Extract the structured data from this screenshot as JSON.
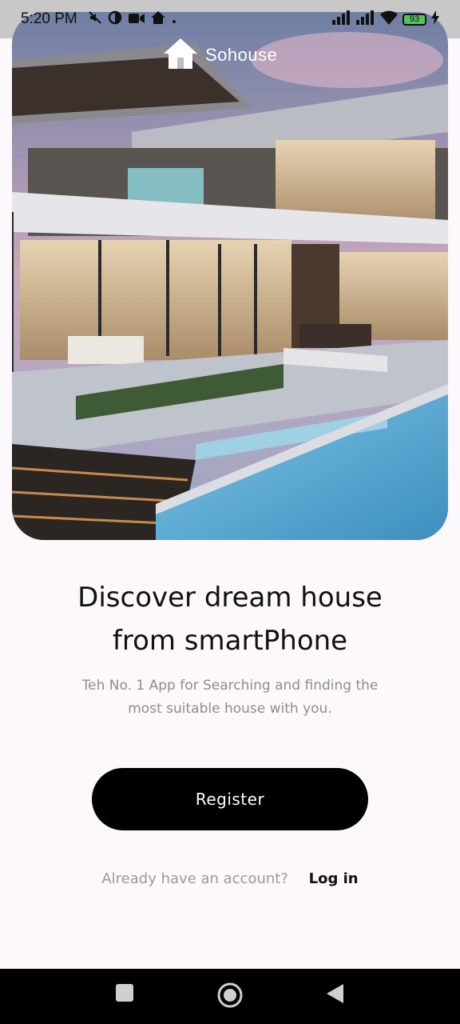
{
  "status_bar": {
    "time": "5:20 PM",
    "battery": "93",
    "icons": [
      "mute-icon",
      "data-saver-icon",
      "video-icon",
      "home-icon",
      "dot-icon",
      "signal-icon",
      "signal-icon",
      "wifi-icon",
      "battery-icon",
      "charging-icon"
    ]
  },
  "brand": {
    "name": "Sohouse",
    "icon": "house-icon"
  },
  "hero": {
    "image": "modern-villa-with-pool"
  },
  "headline": {
    "line1": "Discover dream house",
    "line2": "from smartPhone"
  },
  "subtitle": {
    "line1": "Teh No. 1 App for Searching and finding the",
    "line2": "most suitable house with you."
  },
  "register_label": "Register",
  "login": {
    "prompt": "Already have an account?",
    "link": "Log in"
  },
  "nav_bar": {
    "icons": [
      "recents-square-icon",
      "home-circle-icon",
      "back-triangle-icon"
    ]
  },
  "colors": {
    "background": "#fcf8fc",
    "button": "#000000",
    "subtitle": "#8d8d8d"
  }
}
